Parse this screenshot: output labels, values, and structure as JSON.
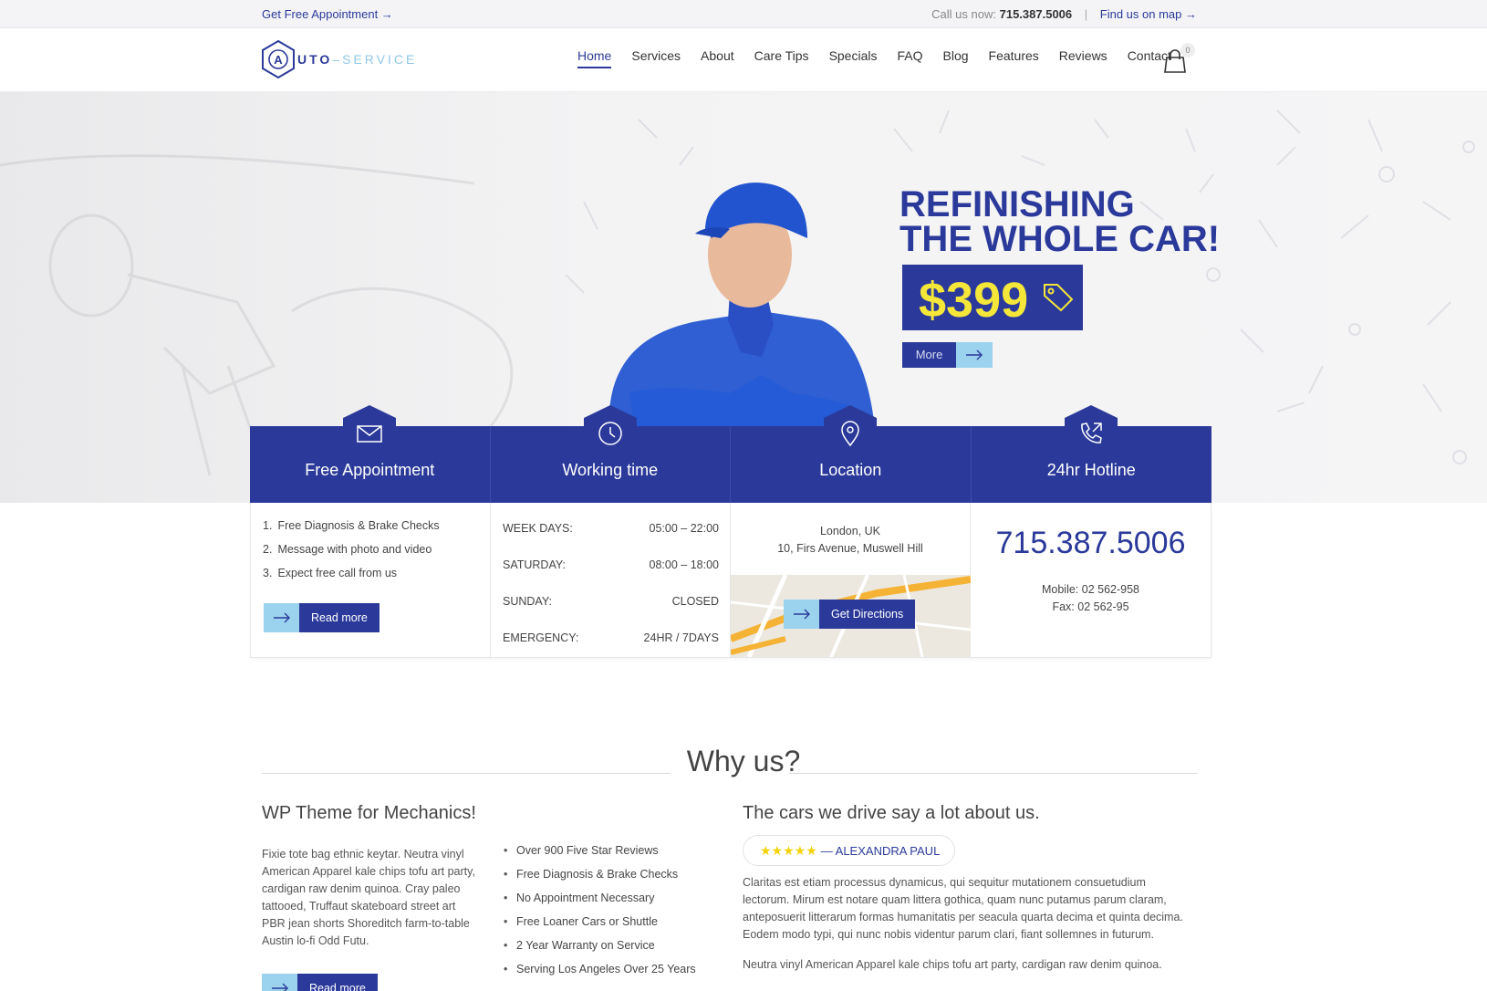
{
  "topbar": {
    "appointment_link": "Get Free Appointment →",
    "call_label": "Call us now:",
    "phone": "715.387.5006",
    "separator": "|",
    "map_link": "Find us on map →"
  },
  "header": {
    "logo_letter": "A",
    "logo_part1": "UTO",
    "logo_part2": "–SERVICE",
    "nav": [
      "Home",
      "Services",
      "About",
      "Care Tips",
      "Specials",
      "FAQ",
      "Blog",
      "Features",
      "Reviews",
      "Contact"
    ],
    "cart_count": "0"
  },
  "hero": {
    "title": "REFINISHING\nTHE WHOLE CAR!",
    "price": "$399",
    "more_label": "More"
  },
  "tabs": [
    {
      "title": "Free Appointment",
      "icon": "envelope-icon"
    },
    {
      "title": "Working time",
      "icon": "clock-icon"
    },
    {
      "title": "Location",
      "icon": "map-pin-icon"
    },
    {
      "title": "24hr Hotline",
      "icon": "phone-icon"
    }
  ],
  "appointment": {
    "items": [
      {
        "n": "1.",
        "text": "Free Diagnosis & Brake Checks"
      },
      {
        "n": "2.",
        "text": "Message with photo and video"
      },
      {
        "n": "3.",
        "text": "Expect free call from us"
      }
    ],
    "button": "Read more"
  },
  "hours": [
    {
      "day": "WEEK DAYS:",
      "time": "05:00 – 22:00"
    },
    {
      "day": "SATURDAY:",
      "time": "08:00 – 18:00"
    },
    {
      "day": "SUNDAY:",
      "time": "CLOSED"
    },
    {
      "day": "EMERGENCY:",
      "time": "24HR / 7DAYS"
    }
  ],
  "location": {
    "line1": "London, UK",
    "line2": "10, Firs Avenue, Muswell Hill",
    "button": "Get Directions"
  },
  "hotline": {
    "phone": "715.387.5006",
    "mobile": "Mobile: 02 562-958",
    "fax": "Fax: 02 562-95"
  },
  "why": {
    "title": "Why us?",
    "left_heading": "WP Theme for Mechanics!",
    "left_paragraph": "Fixie tote bag ethnic keytar. Neutra vinyl American Apparel kale chips tofu art party, cardigan raw denim quinoa. Cray paleo tattooed, Truffaut skateboard street art PBR jean shorts Shoreditch farm-to-table Austin lo-fi Odd Futu.",
    "left_button": "Read more",
    "bullets": [
      "Over 900 Five Star Reviews",
      "Free Diagnosis & Brake Checks",
      "No Appointment Necessary",
      "Free Loaner Cars or Shuttle",
      "2 Year Warranty on Service",
      "Serving Los Angeles Over 25 Years"
    ],
    "right_heading": "The cars we drive say a lot about us.",
    "review_stars": "★★★★★",
    "review_author": "— ALEXANDRA PAUL",
    "review_text": "Claritas est etiam processus dynamicus, qui sequitur mutationem consuetudium lectorum. Mirum est notare quam littera gothica, quam nunc putamus parum claram, anteposuerit litterarum formas humanitatis per seacula quarta decima et quinta decima. Eodem modo typi, qui nunc nobis videntur parum clari, fiant sollemnes in futurum.",
    "review_text2": "Neutra vinyl American Apparel kale chips tofu art party, cardigan raw denim quinoa."
  },
  "colors": {
    "brand_blue": "#2b3a9a",
    "accent_light_blue": "#9bd3ee",
    "price_yellow": "#f5e63a"
  }
}
